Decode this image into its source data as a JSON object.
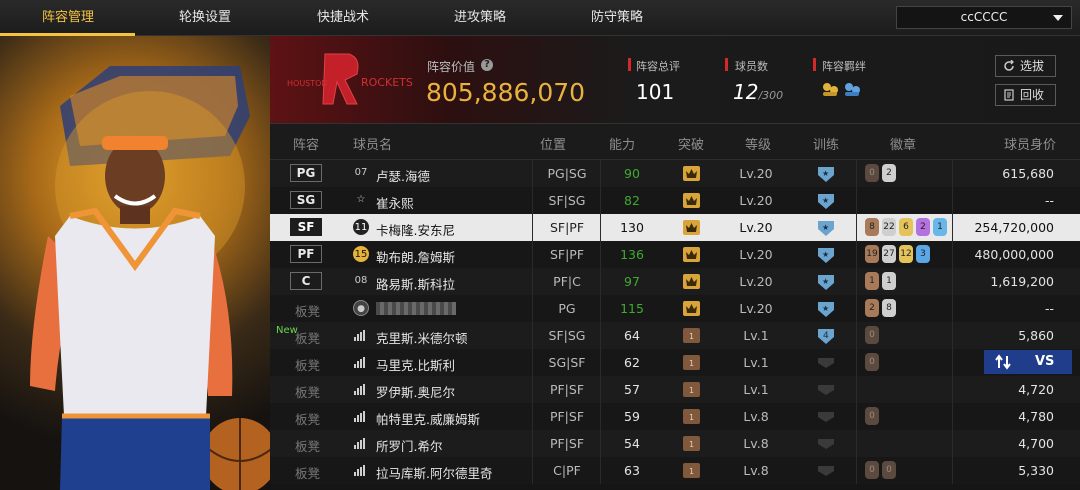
{
  "tabs": [
    "阵容管理",
    "轮换设置",
    "快捷战术",
    "进攻策略",
    "防守策略"
  ],
  "user": "ccCCCC",
  "team_logo_text": "ROCKETS",
  "lineup_value_label": "阵容价值",
  "lineup_value": "805,886,070",
  "rating_label": "阵容总评",
  "rating": "101",
  "count_label": "球员数",
  "count": "12",
  "count_max": "/300",
  "bond_label": "阵容羁绊",
  "btn_pick": "选拔",
  "btn_recycle": "回收",
  "headers": [
    "阵容",
    "球员名",
    "位置",
    "能力",
    "突破",
    "等级",
    "训练",
    "徽章",
    "球员身价"
  ],
  "rows": [
    {
      "pos": "PG",
      "num": "07",
      "name": "卢瑟.海德",
      "posn": "PG|SG",
      "ability": "90",
      "ab_color": "#3faa2f",
      "breakthrough": "gold",
      "level": "Lv.20",
      "train": "star",
      "badges": [
        {
          "v": "0",
          "c": "#5a4a40"
        },
        {
          "v": "2",
          "c": "#cfcfcf"
        }
      ],
      "value": "615,680"
    },
    {
      "pos": "SG",
      "num": "",
      "name": "崔永熙",
      "posn": "SF|SG",
      "ability": "82",
      "ab_color": "#3faa2f",
      "breakthrough": "gold",
      "level": "Lv.20",
      "train": "star",
      "badges": [],
      "value": "--"
    },
    {
      "pos": "SF",
      "num": "11",
      "name": "卡梅隆.安东尼",
      "posn": "SF|PF",
      "ability": "130",
      "ab_color": "#111",
      "breakthrough": "gold",
      "level": "Lv.20",
      "train": "star",
      "badges": [
        {
          "v": "8",
          "c": "#a87a5a"
        },
        {
          "v": "22",
          "c": "#cfcfcf"
        },
        {
          "v": "6",
          "c": "#e3c35a"
        },
        {
          "v": "2",
          "c": "#b472e0"
        },
        {
          "v": "1",
          "c": "#69b6e8"
        }
      ],
      "value": "254,720,000"
    },
    {
      "pos": "PF",
      "num": "15",
      "name": "勒布朗.詹姆斯",
      "posn": "SF|PF",
      "ability": "136",
      "ab_color": "#3faa2f",
      "breakthrough": "gold",
      "level": "Lv.20",
      "train": "star",
      "badges": [
        {
          "v": "19",
          "c": "#a87a5a"
        },
        {
          "v": "27",
          "c": "#cfcfcf"
        },
        {
          "v": "12",
          "c": "#e3c35a"
        },
        {
          "v": "3",
          "c": "#5aa7e8"
        }
      ],
      "value": "480,000,000"
    },
    {
      "pos": "C",
      "num": "08",
      "name": "路易斯.斯科拉",
      "posn": "PF|C",
      "ability": "97",
      "ab_color": "#3faa2f",
      "breakthrough": "gold",
      "level": "Lv.20",
      "train": "star",
      "badges": [
        {
          "v": "1",
          "c": "#a87a5a"
        },
        {
          "v": "1",
          "c": "#cfcfcf"
        }
      ],
      "value": "1,619,200"
    },
    {
      "pos": "板凳",
      "num": "",
      "name": "",
      "posn": "PG",
      "ability": "115",
      "ab_color": "#3faa2f",
      "breakthrough": "gold",
      "level": "Lv.20",
      "train": "star",
      "badges": [
        {
          "v": "2",
          "c": "#a87a5a"
        },
        {
          "v": "8",
          "c": "#cfcfcf"
        }
      ],
      "value": "--"
    },
    {
      "pos": "板凳",
      "num": "",
      "name": "克里斯.米德尔顿",
      "posn": "SF|SG",
      "ability": "64",
      "ab_color": "#e4e4e4",
      "breakthrough": "brown",
      "level": "Lv.1",
      "train": "num4",
      "badges": [
        {
          "v": "0",
          "c": "#5a4a40"
        }
      ],
      "value": "5,860",
      "new": "New"
    },
    {
      "pos": "板凳",
      "num": "",
      "name": "马里克.比斯利",
      "posn": "SG|SF",
      "ability": "62",
      "ab_color": "#e4e4e4",
      "breakthrough": "brown",
      "level": "Lv.1",
      "train": "dim",
      "badges": [
        {
          "v": "0",
          "c": "#5a4a40"
        }
      ],
      "value": "5"
    },
    {
      "pos": "板凳",
      "num": "",
      "name": "罗伊斯.奥尼尔",
      "posn": "PF|SF",
      "ability": "57",
      "ab_color": "#e4e4e4",
      "breakthrough": "brown",
      "level": "Lv.1",
      "train": "dim",
      "badges": [],
      "value": "4,720"
    },
    {
      "pos": "板凳",
      "num": "",
      "name": "帕特里克.威廉姆斯",
      "posn": "PF|SF",
      "ability": "59",
      "ab_color": "#e4e4e4",
      "breakthrough": "brown",
      "level": "Lv.8",
      "train": "dim",
      "badges": [
        {
          "v": "0",
          "c": "#5a4a40"
        }
      ],
      "value": "4,780"
    },
    {
      "pos": "板凳",
      "num": "",
      "name": "所罗门.希尔",
      "posn": "PF|SF",
      "ability": "54",
      "ab_color": "#e4e4e4",
      "breakthrough": "brown",
      "level": "Lv.8",
      "train": "dim",
      "badges": [],
      "value": "4,700"
    },
    {
      "pos": "板凳",
      "num": "",
      "name": "拉马库斯.阿尔德里奇",
      "posn": "C|PF",
      "ability": "63",
      "ab_color": "#e4e4e4",
      "breakthrough": "brown",
      "level": "Lv.8",
      "train": "dim",
      "badges": [
        {
          "v": "0",
          "c": "#5a4a40"
        },
        {
          "v": "0",
          "c": "#5a4a40"
        }
      ],
      "value": "5,330"
    }
  ],
  "vs_label": "VS",
  "colors": {
    "accent": "#f5c342",
    "value": "#e8b23c",
    "ability_green": "#3faa2f",
    "selected_row": "#e9e9e9",
    "vs_button": "#1f3d8a"
  }
}
